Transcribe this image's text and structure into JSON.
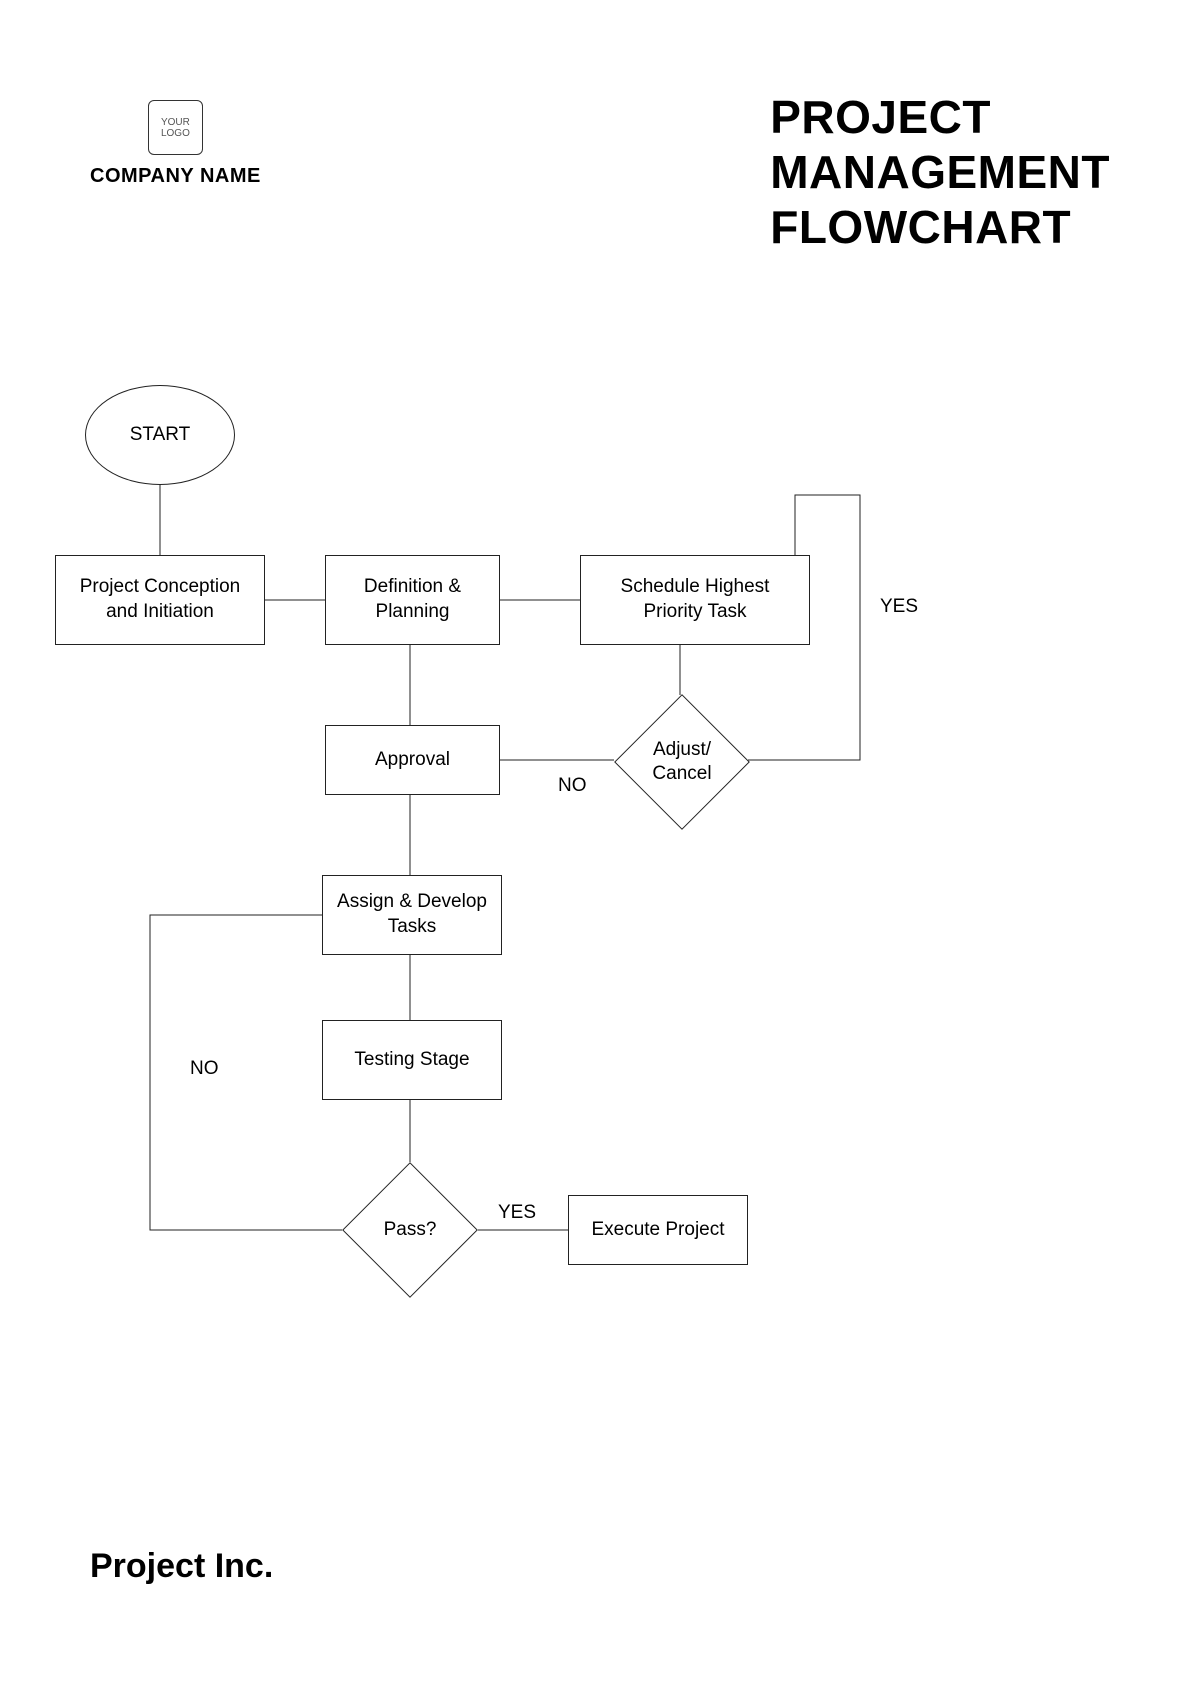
{
  "header": {
    "logo_text": "YOUR\nLOGO",
    "company_name": "COMPANY NAME",
    "title_line1": "PROJECT",
    "title_line2": "MANAGEMENT",
    "title_line3": "FLOWCHART"
  },
  "nodes": {
    "start": "START",
    "conception": "Project Conception\nand Initiation",
    "definition": "Definition &\nPlanning",
    "schedule": "Schedule Highest\nPriority Task",
    "approval": "Approval",
    "adjust": "Adjust/\nCancel",
    "assign": "Assign & Develop\nTasks",
    "testing": "Testing Stage",
    "pass": "Pass?",
    "execute": "Execute Project"
  },
  "edges": {
    "adjust_yes": "YES",
    "adjust_no": "NO",
    "pass_yes": "YES",
    "pass_no": "NO"
  },
  "footer": {
    "company": "Project Inc."
  }
}
